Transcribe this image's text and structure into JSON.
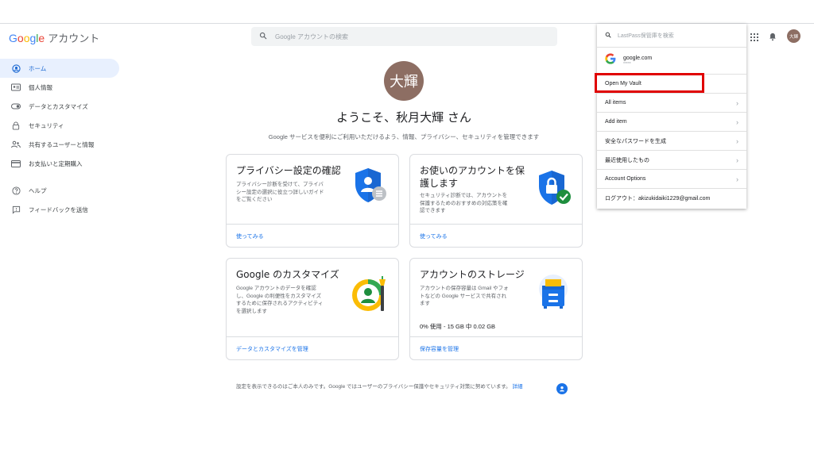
{
  "header": {
    "logo_google": [
      "G",
      "o",
      "o",
      "g",
      "l",
      "e"
    ],
    "logo_suffix": "アカウント",
    "search_placeholder": "Google アカウントの検索",
    "avatar_text": "大輝"
  },
  "sidebar": {
    "items": [
      {
        "label": "ホーム",
        "icon": "account-circle-icon"
      },
      {
        "label": "個人情報",
        "icon": "id-card-icon"
      },
      {
        "label": "データとカスタマイズ",
        "icon": "toggle-icon"
      },
      {
        "label": "セキュリティ",
        "icon": "lock-icon"
      },
      {
        "label": "共有するユーザーと情報",
        "icon": "people-icon"
      },
      {
        "label": "お支払いと定期購入",
        "icon": "credit-card-icon"
      }
    ],
    "help_items": [
      {
        "label": "ヘルプ",
        "icon": "help-icon"
      },
      {
        "label": "フィードバックを送信",
        "icon": "feedback-icon"
      }
    ]
  },
  "main": {
    "avatar_text": "大輝",
    "welcome": "ようこそ、秋月大輝 さん",
    "subtitle": "Google サービスを便利にご利用いただけるよう、情報、プライバシー、セキュリティを管理できます",
    "cards": [
      {
        "title": "プライバシー設定の確認",
        "desc": [
          "プライバシー診断を受けて、プライバ",
          "シー設定の選択に役立つ詳しいガイド",
          "をご覧ください"
        ],
        "link": "使ってみる"
      },
      {
        "title_lines": [
          "お使いのアカウントを保",
          "護します"
        ],
        "desc": [
          "セキュリティ診断では、アカウントを",
          "保護するためのおすすめの対応策を確",
          "認できます"
        ],
        "link": "使ってみる"
      },
      {
        "title": "Google のカスタマイズ",
        "desc": [
          "Google アカウントのデータを確認",
          "し、Google の利便性をカスタマイズ",
          "するために保存されるアクティビティ",
          "を選択します"
        ],
        "link": "データとカスタマイズを管理"
      },
      {
        "title": "アカウントのストレージ",
        "desc": [
          "アカウントの保存容量は Gmail やフォ",
          "トなどの Google サービスで共有され",
          "ます"
        ],
        "usage": "0% 使用 - 15 GB 中 0.02 GB",
        "usage_fraction": 0.0013,
        "link": "保存容量を管理"
      }
    ],
    "footer_text": "設定を表示できるのはご本人のみです。Google ではユーザーのプライバシー保護やセキュリティ対策に努めています。",
    "footer_link": "詳細"
  },
  "lastpass": {
    "search_placeholder": "LastPass保管庫を検索",
    "site_name": "google.com",
    "site_password": "*****",
    "menu": [
      {
        "label": "Open My Vault",
        "arrow": false
      },
      {
        "label": "All items",
        "arrow": true
      },
      {
        "label": "Add item",
        "arrow": true
      },
      {
        "label": "安全なパスワードを生成",
        "arrow": true
      },
      {
        "label": "最近使用したもの",
        "arrow": true
      },
      {
        "label": "Account Options",
        "arrow": true
      }
    ],
    "logout": "ログアウト：akizukidaiki1229@gmail.com"
  },
  "colors": {
    "accent": "#1a73e8",
    "active_bg": "#e8f0fe",
    "highlight": "#e00000",
    "avatar": "#8d6e63"
  }
}
